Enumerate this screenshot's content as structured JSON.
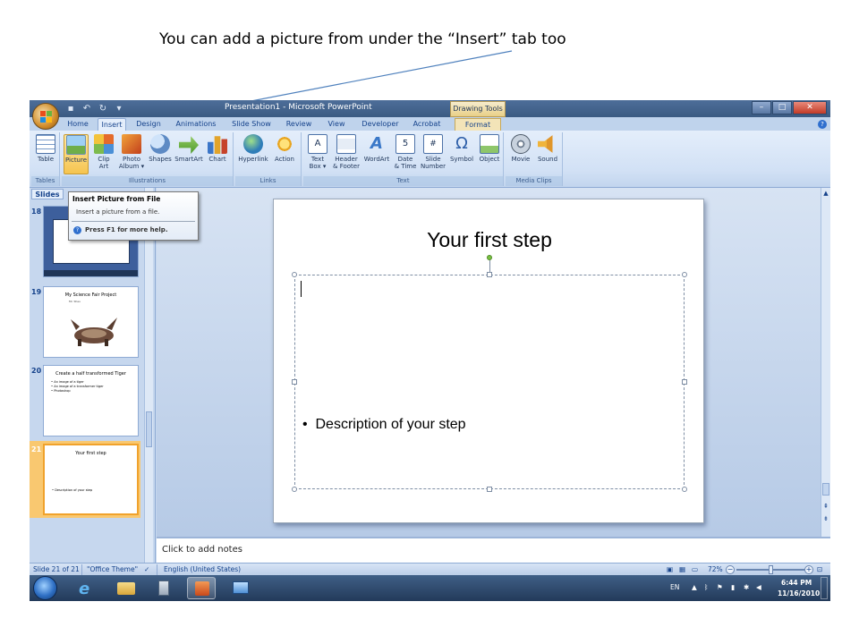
{
  "annotation": {
    "caption": "You can add a picture from under the “Insert” tab too"
  },
  "window": {
    "title": "Presentation1 - Microsoft PowerPoint",
    "contextual_tab_group": "Drawing Tools",
    "controls": [
      "minimize",
      "maximize",
      "close"
    ]
  },
  "ribbon": {
    "tabs": [
      "Home",
      "Insert",
      "Design",
      "Animations",
      "Slide Show",
      "Review",
      "View",
      "Developer",
      "Acrobat",
      "Format"
    ],
    "active_tab": "Insert",
    "groups": [
      {
        "label": "Tables",
        "buttons": [
          "Table"
        ]
      },
      {
        "label": "Illustrations",
        "buttons": [
          "Picture",
          "Clip\nArt",
          "Photo\nAlbum ▾",
          "Shapes",
          "SmartArt",
          "Chart"
        ]
      },
      {
        "label": "Links",
        "buttons": [
          "Hyperlink",
          "Action"
        ]
      },
      {
        "label": "Text",
        "buttons": [
          "Text\nBox ▾",
          "Header\n& Footer",
          "WordArt",
          "Date\n& Time",
          "Slide\nNumber",
          "Symbol",
          "Object"
        ]
      },
      {
        "label": "Media Clips",
        "buttons": [
          "Movie",
          "Sound"
        ]
      }
    ]
  },
  "tooltip": {
    "title": "Insert Picture from File",
    "description": "Insert a picture from a file.",
    "help": "Press F1 for more help."
  },
  "slides_pane": {
    "tab_label": "Slides",
    "thumbnails": [
      {
        "number": "18",
        "title": "",
        "subtitle": "",
        "bullets": []
      },
      {
        "number": "19",
        "title": "My Science Fair Project",
        "subtitle": "Mr. Sheu",
        "bullets": []
      },
      {
        "number": "20",
        "title": "Create a half transformed Tiger",
        "subtitle": "",
        "bullets": [
          "An image of a tiger",
          "An image of a transformer tiger",
          "Photoshop"
        ]
      },
      {
        "number": "21",
        "title": "Your first step",
        "subtitle": "",
        "bullets": [
          "Description of your step"
        ]
      }
    ]
  },
  "slide": {
    "title": "Your first step",
    "bullet": "Description of your step"
  },
  "notes": {
    "placeholder": "Click to add notes"
  },
  "status_bar": {
    "slide_info": "Slide 21 of 21",
    "theme": "\"Office Theme\"",
    "language": "English (United States)",
    "zoom": "72%"
  },
  "taskbar": {
    "language": "EN",
    "time": "6:44 PM",
    "date": "11/16/2010"
  },
  "colors": {
    "ribbon_blue": "#c6d7ee",
    "title_bar": "#3b5a82",
    "pressed_button": "#f6c44f",
    "selected_thumbnail": "#f0a22c",
    "taskbar": "#233a5a"
  }
}
